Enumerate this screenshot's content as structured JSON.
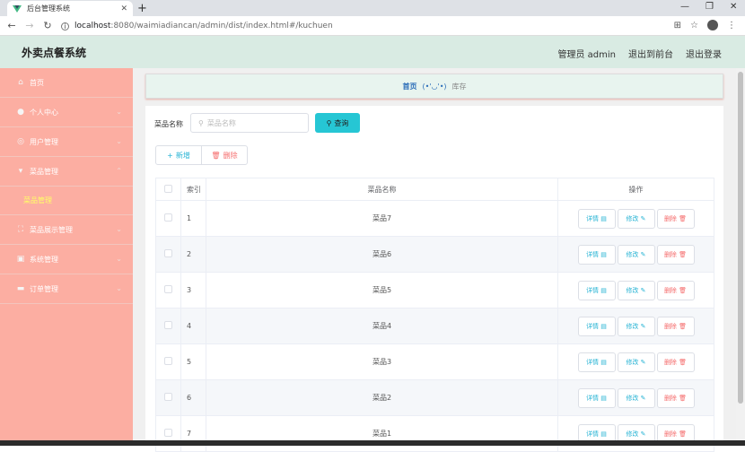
{
  "browser": {
    "tab_title": "后台管理系统",
    "url_host": "localhost",
    "url_path": ":8080/waimiadiancan/admin/dist/index.html#/kuchuen"
  },
  "header": {
    "brand": "外卖点餐系统",
    "admin_label": "管理员 admin",
    "goto_front": "退出到前台",
    "logout": "退出登录"
  },
  "sidebar": {
    "items": [
      {
        "label": "首页",
        "icon": "home-icon",
        "has_chevron": false
      },
      {
        "label": "个人中心",
        "icon": "user-icon",
        "has_chevron": true
      },
      {
        "label": "用户管理",
        "icon": "users-icon",
        "has_chevron": true
      },
      {
        "label": "菜品管理",
        "icon": "dish-icon",
        "has_chevron": true,
        "expanded": true
      },
      {
        "label": "菜品展示管理",
        "icon": "display-icon",
        "has_chevron": true
      },
      {
        "label": "系统管理",
        "icon": "settings-icon",
        "has_chevron": true
      },
      {
        "label": "订单管理",
        "icon": "order-icon",
        "has_chevron": true
      }
    ],
    "submenu_active": "菜品管理"
  },
  "breadcrumb": {
    "home": "首页",
    "face": "(•'◡'•)",
    "current": "库存"
  },
  "search": {
    "label": "菜品名称",
    "placeholder": "菜品名称",
    "query_button": "查询"
  },
  "actions": {
    "add": "新增",
    "delete": "删除"
  },
  "table": {
    "headers": {
      "index": "索引",
      "name": "菜品名称",
      "ops": "操作"
    },
    "ops_labels": {
      "detail": "详情",
      "edit": "修改",
      "remove": "删除"
    },
    "rows": [
      {
        "index": "1",
        "name": "菜品7"
      },
      {
        "index": "2",
        "name": "菜品6"
      },
      {
        "index": "3",
        "name": "菜品5"
      },
      {
        "index": "4",
        "name": "菜品4"
      },
      {
        "index": "5",
        "name": "菜品3"
      },
      {
        "index": "6",
        "name": "菜品2"
      },
      {
        "index": "7",
        "name": "菜品1"
      }
    ]
  },
  "colors": {
    "sidebar_bg": "#fcaea2",
    "header_bg": "#d9ebe3",
    "accent": "#26c6d4",
    "danger": "#f56c6c",
    "active_submenu": "#ffff66"
  }
}
